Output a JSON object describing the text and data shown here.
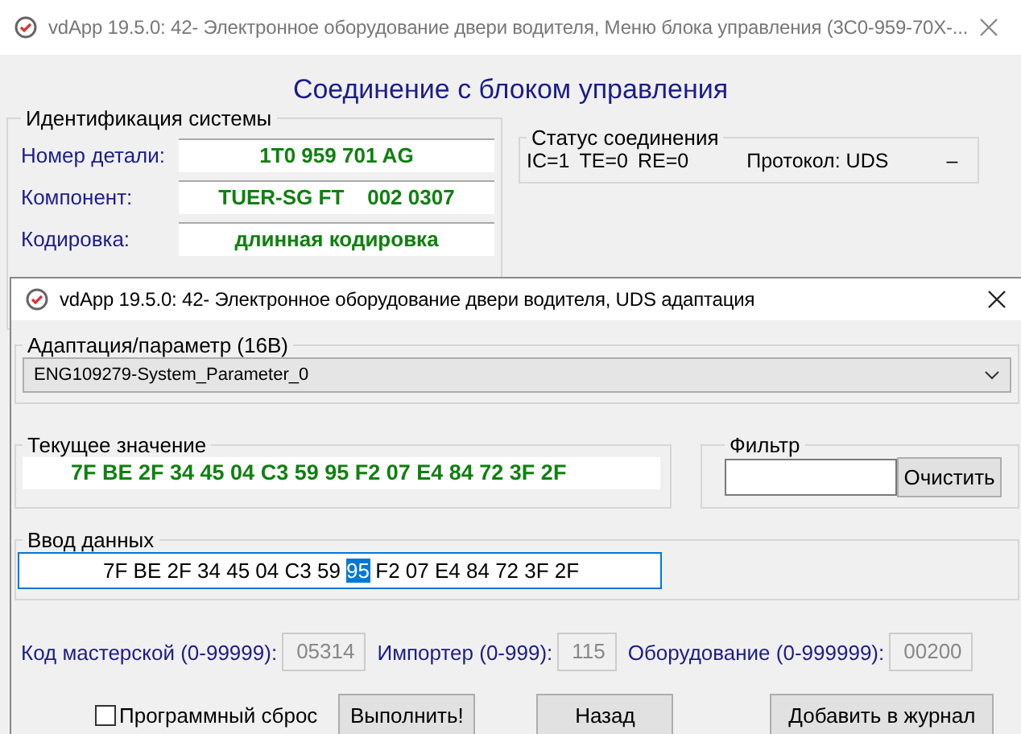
{
  "main_window": {
    "title": "vdApp 19.5.0: 42- Электронное оборудование двери водителя,  Меню блока управления (3C0-959-70X-...",
    "heading": "Соединение с блоком управления",
    "identification": {
      "title": "Идентификация системы",
      "rows": [
        {
          "label": "Номер детали:",
          "value": "1T0 959 701 AG"
        },
        {
          "label": "Компонент:",
          "value": "TUER-SG FT    002 0307"
        },
        {
          "label": "Кодировка:",
          "value": "длинная кодировка"
        }
      ]
    },
    "status": {
      "title": "Статус соединения",
      "ic": "IC=1",
      "te": "TE=0",
      "re": "RE=0",
      "protocol": "Протокол: UDS",
      "dash": "–"
    }
  },
  "dialog": {
    "title": "vdApp 19.5.0: 42- Электронное оборудование двери водителя,  UDS адаптация",
    "adaptation": {
      "title": "Адаптация/параметр (16В)",
      "value": "ENG109279-System_Parameter_0"
    },
    "current": {
      "title": "Текущее значение",
      "value": "7F BE 2F 34 45 04 C3 59 95 F2 07 E4 84 72 3F 2F"
    },
    "filter": {
      "title": "Фильтр",
      "button": "Очистить"
    },
    "input": {
      "title": "Ввод данных",
      "parts": [
        {
          "text": "7F BE 2F 34 45 04 C3 59 ",
          "selected": false
        },
        {
          "text": "95",
          "selected": true
        },
        {
          "text": " F2 07 E4 84 72 3F 2F",
          "selected": false
        }
      ]
    },
    "codes": [
      {
        "label": "Код мастерской (0-99999):",
        "value": "05314"
      },
      {
        "label": "Импортер (0-999):",
        "value": "115"
      },
      {
        "label": "Оборудование (0-999999):",
        "value": "00200"
      }
    ],
    "reset": {
      "label": "Программный сброс",
      "checked": false
    },
    "buttons": [
      "Выполнить!",
      "Назад",
      "Добавить в журнал"
    ]
  }
}
